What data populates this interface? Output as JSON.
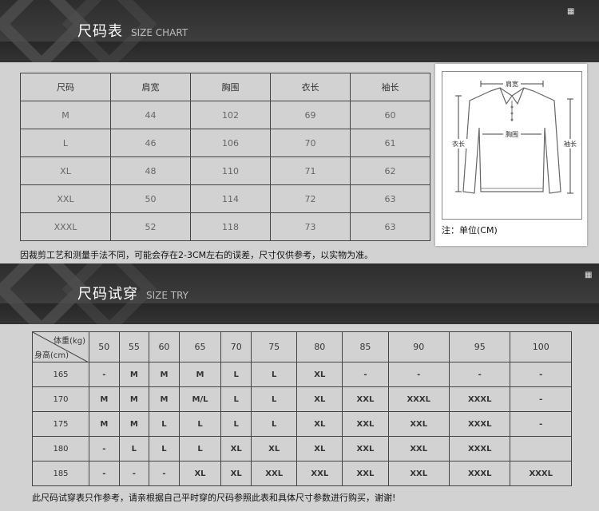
{
  "size_chart": {
    "title_cn": "尺码表",
    "title_en": "SIZE CHART",
    "headers": [
      "尺码",
      "肩宽",
      "胸围",
      "衣长",
      "袖长"
    ],
    "rows": [
      [
        "M",
        "44",
        "102",
        "69",
        "60"
      ],
      [
        "L",
        "46",
        "106",
        "70",
        "61"
      ],
      [
        "XL",
        "48",
        "110",
        "71",
        "62"
      ],
      [
        "XXL",
        "50",
        "114",
        "72",
        "63"
      ],
      [
        "XXXL",
        "52",
        "118",
        "73",
        "63"
      ]
    ],
    "note": "因裁剪工艺和测量手法不同，可能会存在2-3CM左右的误差，尺寸仅供参考，以实物为准。"
  },
  "diagram": {
    "shoulder_label": "肩宽",
    "chest_label": "胸围",
    "length_label": "衣长",
    "sleeve_label": "袖长",
    "unit_note": "注：单位(CM)"
  },
  "size_try": {
    "title_cn": "尺码试穿",
    "title_en": "SIZE TRY",
    "weight_label": "体重(kg)",
    "height_label": "身高(cm)",
    "weights": [
      "50",
      "55",
      "60",
      "65",
      "70",
      "75",
      "80",
      "85",
      "90",
      "95",
      "100"
    ],
    "rows": [
      {
        "height": "165",
        "cells": [
          "-",
          "M",
          "M",
          "M",
          "L",
          "L",
          "XL",
          "-",
          "-",
          "-",
          "-"
        ]
      },
      {
        "height": "170",
        "cells": [
          "M",
          "M",
          "M",
          "M/L",
          "L",
          "L",
          "XL",
          "XXL",
          "XXXL",
          "XXXL",
          "-"
        ]
      },
      {
        "height": "175",
        "cells": [
          "M",
          "M",
          "L",
          "L",
          "L",
          "L",
          "XL",
          "XXL",
          "XXL",
          "XXXL",
          "-"
        ]
      },
      {
        "height": "180",
        "cells": [
          "-",
          "L",
          "L",
          "L",
          "XL",
          "XL",
          "XL",
          "XXL",
          "XXL",
          "XXXL",
          ""
        ]
      },
      {
        "height": "185",
        "cells": [
          "-",
          "-",
          "-",
          "XL",
          "XL",
          "XXL",
          "XXL",
          "XXL",
          "XXL",
          "XXXL",
          "XXXL"
        ]
      }
    ],
    "note": "此尺码试穿表只作参考，请亲根据自己平时穿的尺码参照此表和具体尺寸参数进行购买，谢谢!"
  }
}
